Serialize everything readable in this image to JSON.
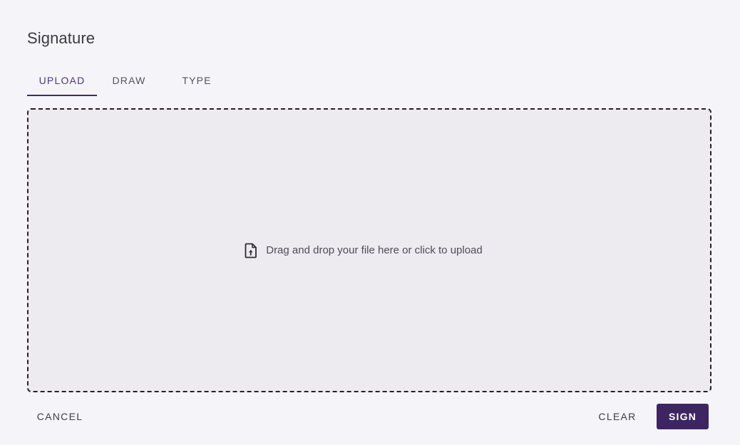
{
  "dialog": {
    "title": "Signature"
  },
  "tabs": [
    {
      "label": "UPLOAD",
      "active": true
    },
    {
      "label": "DRAW",
      "active": false
    },
    {
      "label": "TYPE",
      "active": false
    }
  ],
  "dropzone": {
    "icon": "file-upload-icon",
    "text": "Drag and drop your file here or click to upload"
  },
  "actions": {
    "cancel_label": "CANCEL",
    "clear_label": "CLEAR",
    "sign_label": "SIGN"
  },
  "colors": {
    "accent": "#3d2562",
    "active_tab": "#4a3a78",
    "background": "#f5f4f8",
    "dropzone_bg": "#edebef"
  }
}
